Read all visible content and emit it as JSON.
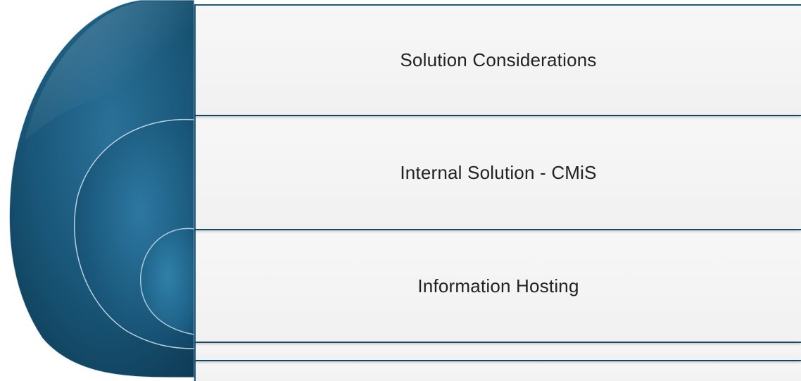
{
  "diagram": {
    "items": [
      {
        "label": "Solution Considerations"
      },
      {
        "label": "Internal Solution - CMiS"
      },
      {
        "label": "Information Hosting"
      },
      {
        "label": ""
      },
      {
        "label": ""
      }
    ]
  },
  "colors": {
    "arc_dark": "#0f3e58",
    "arc_mid": "#1e5f83",
    "arc_light": "#2f7aa2",
    "box_fill": "#f2f2f2",
    "box_border": "#1b5a7a",
    "text": "#222222"
  }
}
